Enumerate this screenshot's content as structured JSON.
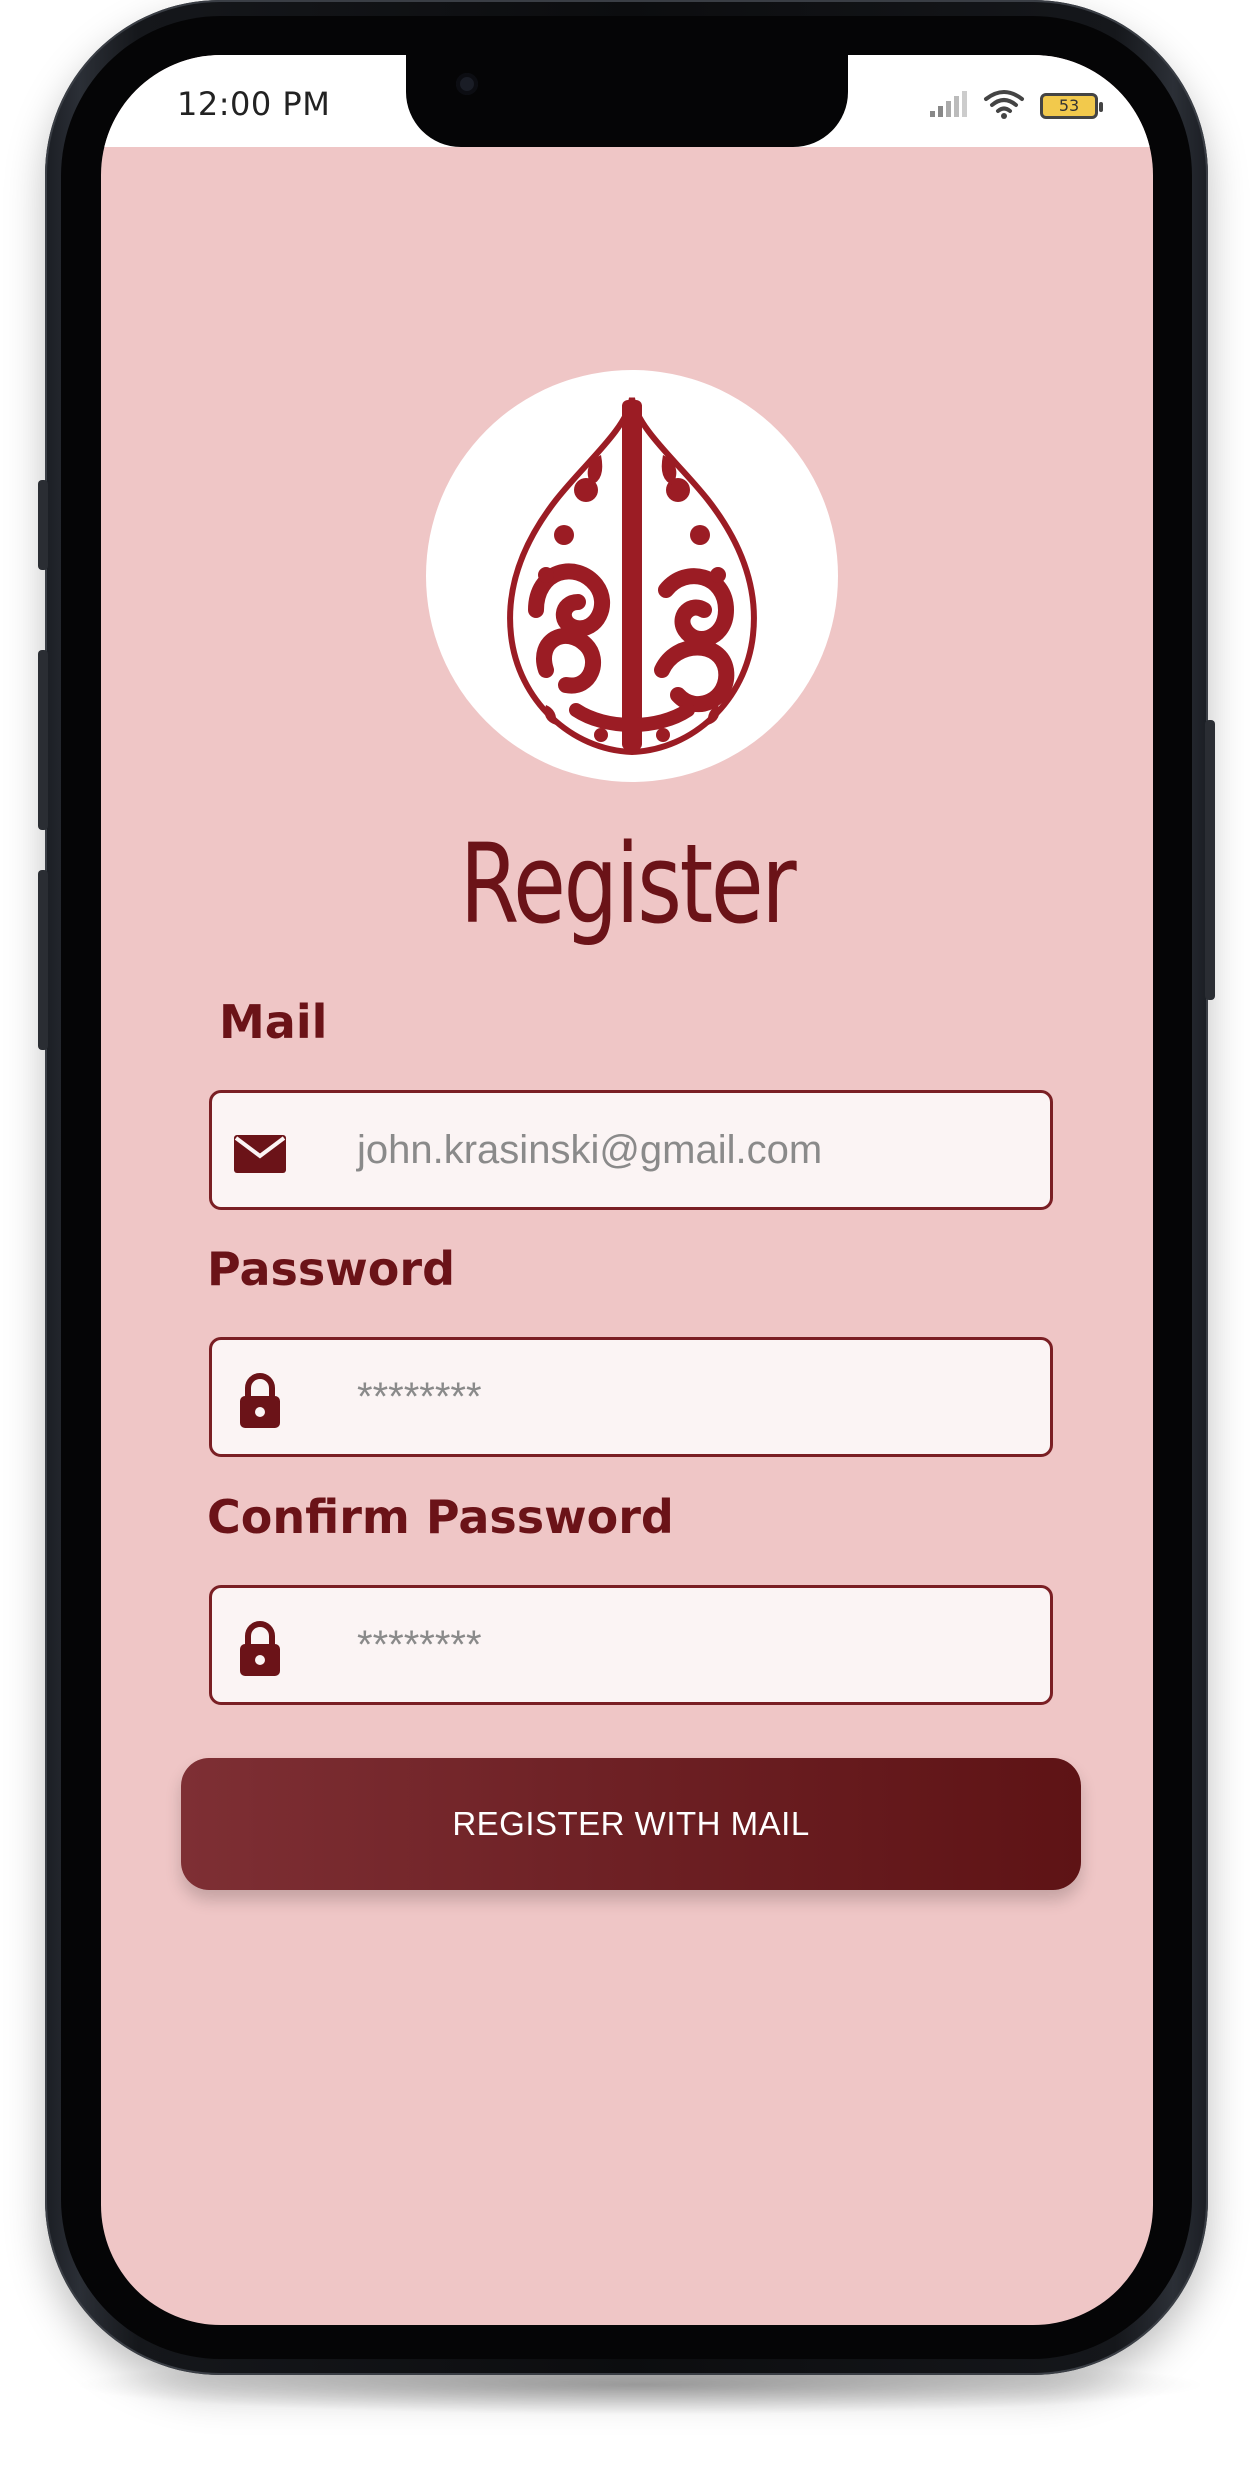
{
  "status_bar": {
    "time": "12:00 PM",
    "battery": "53"
  },
  "page": {
    "title": "Register"
  },
  "form": {
    "mail_label": "Mail",
    "mail_value": "john.krasinski@gmail.com",
    "password_label": "Password",
    "password_value": "********",
    "confirm_password_label": "Confirm Password",
    "confirm_password_value": "********"
  },
  "actions": {
    "register_label": "REGISTER WITH MAIL"
  },
  "colors": {
    "background": "#efc6c6",
    "accent": "#6b1318",
    "logo": "#9b1c24",
    "input_background": "#fbf4f4"
  },
  "icons": {
    "mail": "envelope-icon",
    "password": "lock-icon",
    "confirm_password": "lock-icon",
    "logo": "calligraphy-emblem"
  }
}
